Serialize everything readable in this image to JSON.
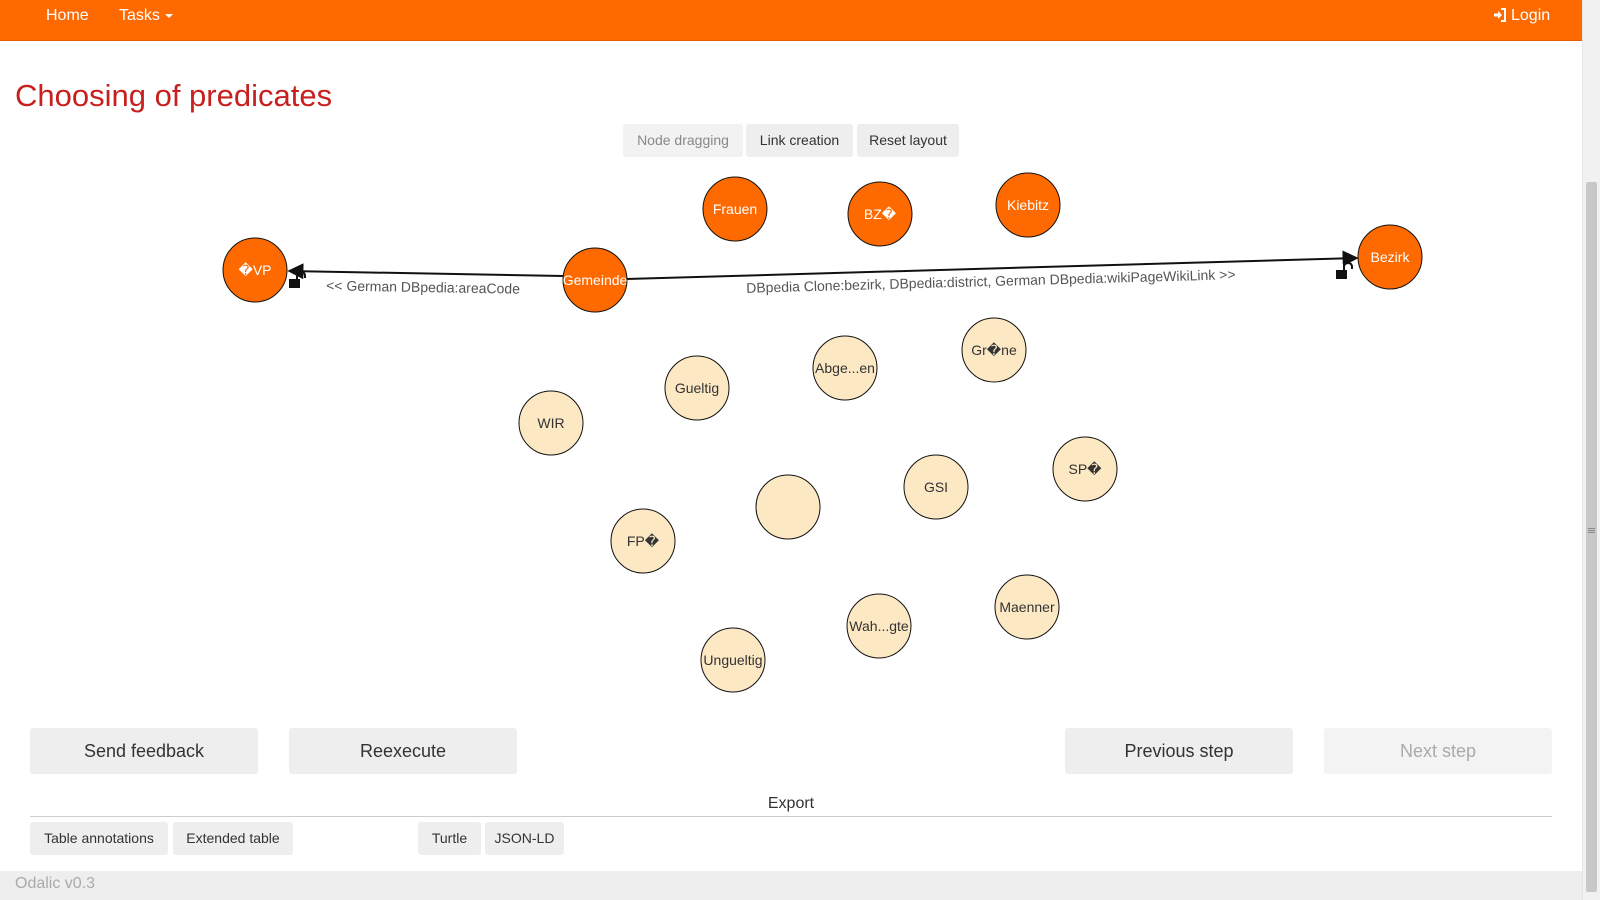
{
  "navbar": {
    "home": "Home",
    "tasks": "Tasks",
    "login": "Login"
  },
  "page": {
    "title": "Choosing of predicates"
  },
  "graph_controls": {
    "node_dragging": "Node dragging",
    "link_creation": "Link creation",
    "reset_layout": "Reset layout"
  },
  "graph": {
    "nodes": {
      "vp": "�VP",
      "gemeinde": "Gemeinde",
      "bezirk": "Bezirk",
      "frauen": "Frauen",
      "bz": "BZ�",
      "kiebitz": "Kiebitz",
      "grune": "Gr�ne",
      "abge": "Abge...en",
      "gueltig": "Gueltig",
      "wir": "WIR",
      "gsi": "GSI",
      "sp": "SP�",
      "empty": "",
      "fp": "FP�",
      "maenner": "Maenner",
      "wahgte": "Wah...gte",
      "ungueltig": "Ungueltig"
    },
    "edges": {
      "left": "<< German DBpedia:areaCode",
      "right": "DBpedia Clone:bezirk, DBpedia:district, German DBpedia:wikiPageWikiLink >>"
    },
    "colors": {
      "selected": "#ff6a00",
      "unselected": "#fde8c4"
    }
  },
  "actions": {
    "send_feedback": "Send feedback",
    "reexecute": "Reexecute",
    "previous_step": "Previous step",
    "next_step": "Next step"
  },
  "export": {
    "label": "Export",
    "table_annotations": "Table annotations",
    "extended_table": "Extended table",
    "turtle": "Turtle",
    "json_ld": "JSON-LD"
  },
  "footer": {
    "version": "Odalic v0.3"
  }
}
